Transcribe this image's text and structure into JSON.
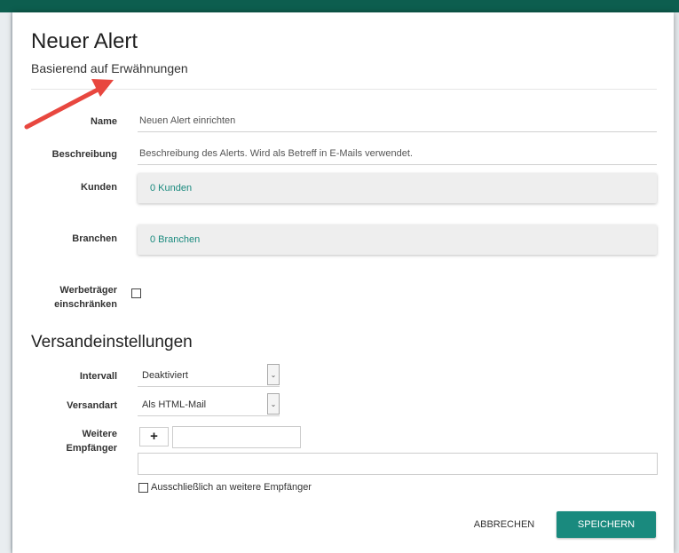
{
  "dialog": {
    "title": "Neuer Alert",
    "subtitle": "Basierend auf Erwähnungen"
  },
  "form": {
    "name_label": "Name",
    "name_value": "Neuen Alert einrichten",
    "description_label": "Beschreibung",
    "description_value": "Beschreibung des Alerts. Wird als Betreff in E-Mails verwendet.",
    "customers_label": "Kunden",
    "customers_value": "0 Kunden",
    "industries_label": "Branchen",
    "industries_value": "0 Branchen",
    "restrict_label_line1": "Werbeträger",
    "restrict_label_line2": "einschränken",
    "restrict_checked": false
  },
  "delivery": {
    "section_title": "Versandeinstellungen",
    "interval_label": "Intervall",
    "interval_value": "Deaktiviert",
    "type_label": "Versandart",
    "type_value": "Als HTML-Mail",
    "recipients_label_line1": "Weitere",
    "recipients_label_line2": "Empfänger",
    "add_symbol": "+",
    "only_recipients_label": "Ausschließlich an weitere Empfänger",
    "only_recipients_checked": false
  },
  "actions": {
    "cancel_label": "ABBRECHEN",
    "save_label": "SPEICHERN"
  },
  "colors": {
    "accent": "#1a8a7e",
    "header_bar": "#0d5e4f",
    "annotation_arrow": "#e8473f"
  },
  "icons": {
    "dropdown": "chevron-down-icon",
    "add": "plus-icon",
    "annotation": "red-arrow-annotation"
  }
}
